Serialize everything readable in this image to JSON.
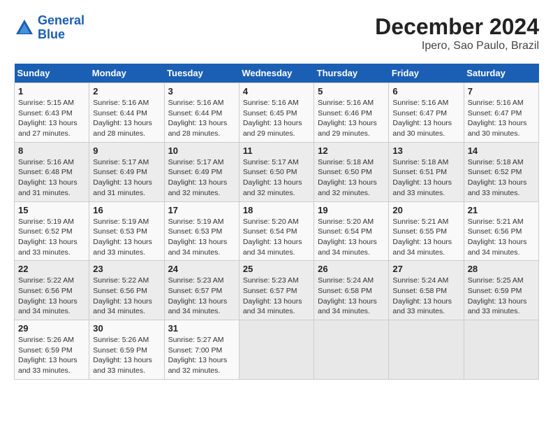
{
  "app": {
    "name": "GeneralBlue",
    "logo_lines": [
      "General",
      "Blue"
    ]
  },
  "title": "December 2024",
  "subtitle": "Ipero, Sao Paulo, Brazil",
  "header": {
    "days": [
      "Sunday",
      "Monday",
      "Tuesday",
      "Wednesday",
      "Thursday",
      "Friday",
      "Saturday"
    ]
  },
  "weeks": [
    [
      {
        "date": "1",
        "sunrise": "5:15 AM",
        "sunset": "6:43 PM",
        "daylight": "13 hours and 27 minutes."
      },
      {
        "date": "2",
        "sunrise": "5:16 AM",
        "sunset": "6:44 PM",
        "daylight": "13 hours and 28 minutes."
      },
      {
        "date": "3",
        "sunrise": "5:16 AM",
        "sunset": "6:44 PM",
        "daylight": "13 hours and 28 minutes."
      },
      {
        "date": "4",
        "sunrise": "5:16 AM",
        "sunset": "6:45 PM",
        "daylight": "13 hours and 29 minutes."
      },
      {
        "date": "5",
        "sunrise": "5:16 AM",
        "sunset": "6:46 PM",
        "daylight": "13 hours and 29 minutes."
      },
      {
        "date": "6",
        "sunrise": "5:16 AM",
        "sunset": "6:47 PM",
        "daylight": "13 hours and 30 minutes."
      },
      {
        "date": "7",
        "sunrise": "5:16 AM",
        "sunset": "6:47 PM",
        "daylight": "13 hours and 30 minutes."
      }
    ],
    [
      {
        "date": "8",
        "sunrise": "5:16 AM",
        "sunset": "6:48 PM",
        "daylight": "13 hours and 31 minutes."
      },
      {
        "date": "9",
        "sunrise": "5:17 AM",
        "sunset": "6:49 PM",
        "daylight": "13 hours and 31 minutes."
      },
      {
        "date": "10",
        "sunrise": "5:17 AM",
        "sunset": "6:49 PM",
        "daylight": "13 hours and 32 minutes."
      },
      {
        "date": "11",
        "sunrise": "5:17 AM",
        "sunset": "6:50 PM",
        "daylight": "13 hours and 32 minutes."
      },
      {
        "date": "12",
        "sunrise": "5:18 AM",
        "sunset": "6:50 PM",
        "daylight": "13 hours and 32 minutes."
      },
      {
        "date": "13",
        "sunrise": "5:18 AM",
        "sunset": "6:51 PM",
        "daylight": "13 hours and 33 minutes."
      },
      {
        "date": "14",
        "sunrise": "5:18 AM",
        "sunset": "6:52 PM",
        "daylight": "13 hours and 33 minutes."
      }
    ],
    [
      {
        "date": "15",
        "sunrise": "5:19 AM",
        "sunset": "6:52 PM",
        "daylight": "13 hours and 33 minutes."
      },
      {
        "date": "16",
        "sunrise": "5:19 AM",
        "sunset": "6:53 PM",
        "daylight": "13 hours and 33 minutes."
      },
      {
        "date": "17",
        "sunrise": "5:19 AM",
        "sunset": "6:53 PM",
        "daylight": "13 hours and 34 minutes."
      },
      {
        "date": "18",
        "sunrise": "5:20 AM",
        "sunset": "6:54 PM",
        "daylight": "13 hours and 34 minutes."
      },
      {
        "date": "19",
        "sunrise": "5:20 AM",
        "sunset": "6:54 PM",
        "daylight": "13 hours and 34 minutes."
      },
      {
        "date": "20",
        "sunrise": "5:21 AM",
        "sunset": "6:55 PM",
        "daylight": "13 hours and 34 minutes."
      },
      {
        "date": "21",
        "sunrise": "5:21 AM",
        "sunset": "6:56 PM",
        "daylight": "13 hours and 34 minutes."
      }
    ],
    [
      {
        "date": "22",
        "sunrise": "5:22 AM",
        "sunset": "6:56 PM",
        "daylight": "13 hours and 34 minutes."
      },
      {
        "date": "23",
        "sunrise": "5:22 AM",
        "sunset": "6:56 PM",
        "daylight": "13 hours and 34 minutes."
      },
      {
        "date": "24",
        "sunrise": "5:23 AM",
        "sunset": "6:57 PM",
        "daylight": "13 hours and 34 minutes."
      },
      {
        "date": "25",
        "sunrise": "5:23 AM",
        "sunset": "6:57 PM",
        "daylight": "13 hours and 34 minutes."
      },
      {
        "date": "26",
        "sunrise": "5:24 AM",
        "sunset": "6:58 PM",
        "daylight": "13 hours and 34 minutes."
      },
      {
        "date": "27",
        "sunrise": "5:24 AM",
        "sunset": "6:58 PM",
        "daylight": "13 hours and 33 minutes."
      },
      {
        "date": "28",
        "sunrise": "5:25 AM",
        "sunset": "6:59 PM",
        "daylight": "13 hours and 33 minutes."
      }
    ],
    [
      {
        "date": "29",
        "sunrise": "5:26 AM",
        "sunset": "6:59 PM",
        "daylight": "13 hours and 33 minutes."
      },
      {
        "date": "30",
        "sunrise": "5:26 AM",
        "sunset": "6:59 PM",
        "daylight": "13 hours and 33 minutes."
      },
      {
        "date": "31",
        "sunrise": "5:27 AM",
        "sunset": "7:00 PM",
        "daylight": "13 hours and 32 minutes."
      },
      null,
      null,
      null,
      null
    ]
  ],
  "labels": {
    "sunrise": "Sunrise:",
    "sunset": "Sunset:",
    "daylight": "Daylight:"
  }
}
